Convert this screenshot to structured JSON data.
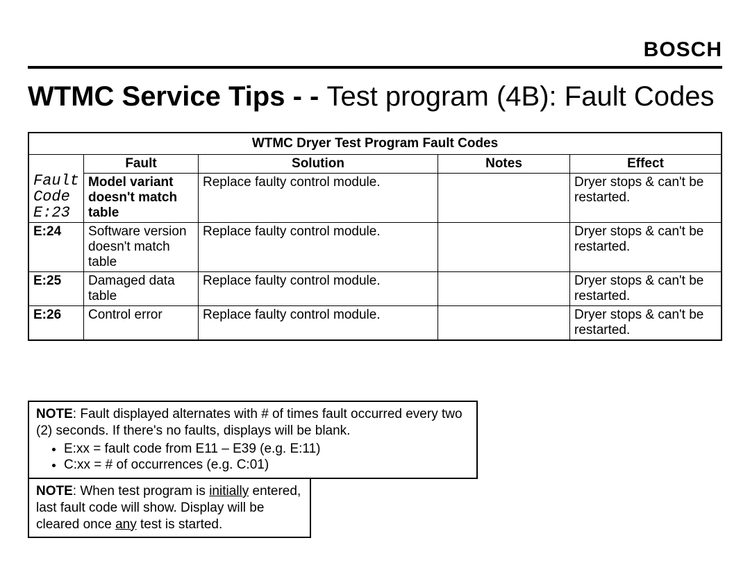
{
  "brand": "BOSCH",
  "title_bold": "WTMC Service Tips - - ",
  "title_rest": "Test program (4B): Fault Codes",
  "table": {
    "caption": "WTMC Dryer Test Program Fault Codes",
    "header": {
      "col1a": "Fault",
      "col1b": "Code",
      "col1c": "E:23",
      "col2": "Fault",
      "col3": "Solution",
      "col4": "Notes",
      "col5": "Effect"
    },
    "rows": [
      {
        "code": "",
        "fault": "Model variant doesn't match table",
        "solution": "Replace faulty control module.",
        "notes": "",
        "effect": "Dryer stops & can't be restarted."
      },
      {
        "code": "E:24",
        "fault": "Software version doesn't match table",
        "solution": "Replace faulty control module.",
        "notes": "",
        "effect": "Dryer stops & can't be restarted."
      },
      {
        "code": "E:25",
        "fault": "Damaged data table",
        "solution": "Replace faulty control module.",
        "notes": "",
        "effect": "Dryer stops & can't be restarted."
      },
      {
        "code": "E:26",
        "fault": "Control error",
        "solution": "Replace faulty control module.",
        "notes": "",
        "effect": "Dryer stops & can't be restarted."
      }
    ]
  },
  "note1": {
    "lead": ": Fault displayed alternates with # of times fault occurred every two (2) seconds. If there's no faults, displays will be blank.",
    "bullets": [
      "E:xx = fault code from E11 – E39 (e.g. E:11)",
      "C:xx = # of occurrences (e.g. C:01)"
    ]
  },
  "note2": {
    "before_initially": ": When test program is ",
    "initially": "initially",
    "after_initially": " entered, last fault code will show. Display will be cleared once ",
    "any": "any",
    "after_any": " test is started."
  },
  "labels": {
    "note": "NOTE"
  }
}
